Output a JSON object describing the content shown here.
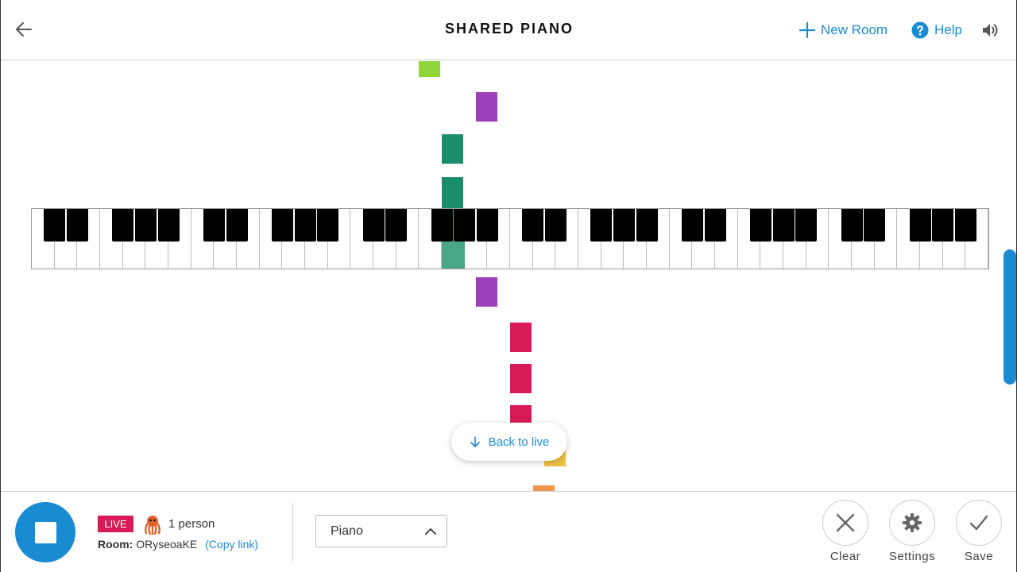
{
  "header": {
    "title": "SHARED PIANO",
    "new_room_label": "New Room",
    "help_label": "Help",
    "accent_color": "#1a8bd1"
  },
  "stage": {
    "back_to_live_label": "Back to live",
    "note_colors": {
      "green": "#8fd53a",
      "purple": "#9c3fb8",
      "teal": "#1b8c6c",
      "teal_active": "#4aa889",
      "crimson": "#d81b56",
      "yellow": "#f0c044",
      "orange": "#f0954a"
    }
  },
  "footer": {
    "live_badge": "LIVE",
    "people_count": "1 person",
    "room_label": "Room:",
    "room_code": "ORyseoaKE",
    "copy_link_label": "(Copy link)",
    "instrument_selected": "Piano",
    "clear_label": "Clear",
    "settings_label": "Settings",
    "save_label": "Save"
  },
  "icons": {
    "back": "arrow-left-icon",
    "new_room": "plus-icon",
    "help": "question-circle-icon",
    "volume": "speaker-icon",
    "stop": "stop-icon",
    "avatar": "octopus-icon",
    "dropdown": "chevron-up-icon",
    "clear": "close-icon",
    "settings": "gear-icon",
    "save": "check-icon",
    "back_to_live": "arrow-down-icon"
  }
}
